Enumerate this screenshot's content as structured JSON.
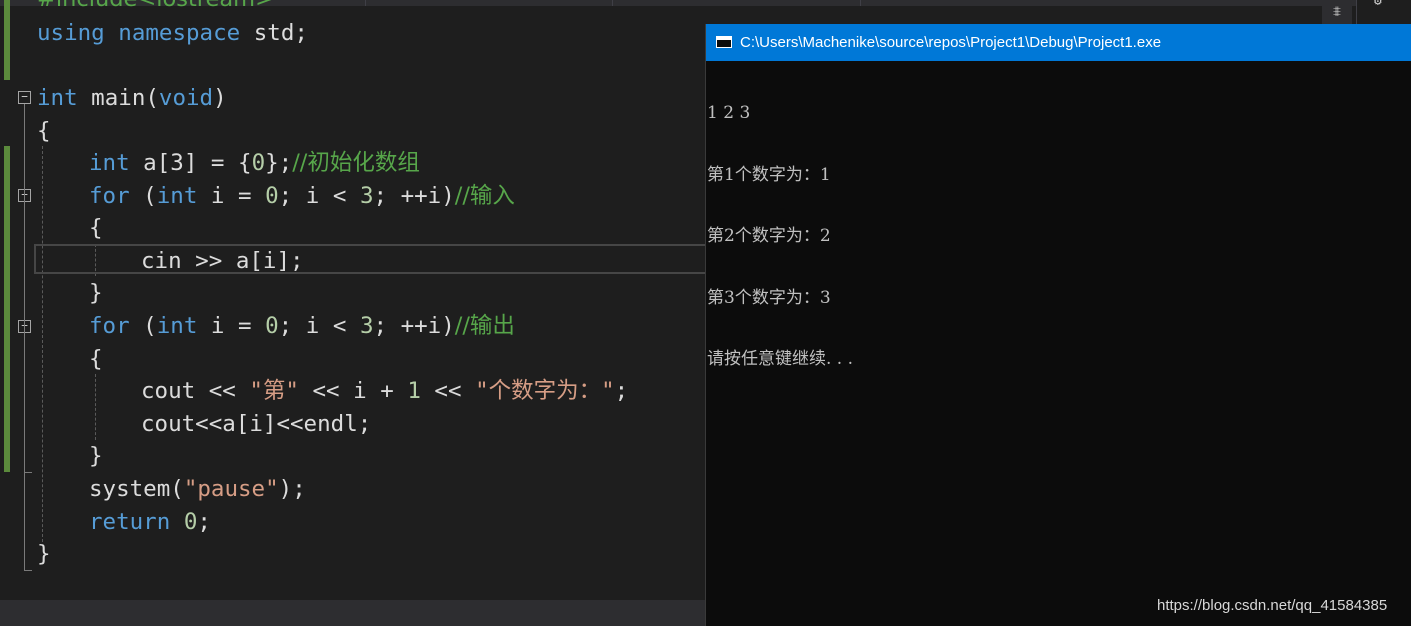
{
  "editor": {
    "lines": [
      {
        "id": "l1",
        "tokens": [
          {
            "t": "#include<iostream>",
            "c": "cm"
          }
        ]
      },
      {
        "id": "l2",
        "tokens": [
          {
            "t": "using",
            "c": "kw"
          },
          {
            "t": " "
          },
          {
            "t": "namespace",
            "c": "kw"
          },
          {
            "t": " std;"
          }
        ]
      },
      {
        "id": "l3",
        "tokens": [
          {
            "t": "int",
            "c": "kw"
          },
          {
            "t": " main("
          },
          {
            "t": "void",
            "c": "kw"
          },
          {
            "t": ")"
          }
        ]
      },
      {
        "id": "l4",
        "tokens": [
          {
            "t": "{"
          }
        ]
      },
      {
        "id": "l5",
        "tokens": [
          {
            "t": "int",
            "c": "kw"
          },
          {
            "t": " a[3] = {"
          },
          {
            "t": "0",
            "c": "nm"
          },
          {
            "t": "};"
          },
          {
            "t": "//初始化数组",
            "c": "cm"
          }
        ]
      },
      {
        "id": "l6",
        "tokens": [
          {
            "t": "for",
            "c": "kw"
          },
          {
            "t": " ("
          },
          {
            "t": "int",
            "c": "kw"
          },
          {
            "t": " i = "
          },
          {
            "t": "0",
            "c": "nm"
          },
          {
            "t": "; i < "
          },
          {
            "t": "3",
            "c": "nm"
          },
          {
            "t": "; ++i)"
          },
          {
            "t": "//输入",
            "c": "cm"
          }
        ]
      },
      {
        "id": "l7",
        "tokens": [
          {
            "t": "{"
          }
        ]
      },
      {
        "id": "l8",
        "tokens": [
          {
            "t": "cin >> a[i];"
          }
        ]
      },
      {
        "id": "l9",
        "tokens": [
          {
            "t": "}"
          }
        ]
      },
      {
        "id": "l10",
        "tokens": [
          {
            "t": "for",
            "c": "kw"
          },
          {
            "t": " ("
          },
          {
            "t": "int",
            "c": "kw"
          },
          {
            "t": " i = "
          },
          {
            "t": "0",
            "c": "nm"
          },
          {
            "t": "; i < "
          },
          {
            "t": "3",
            "c": "nm"
          },
          {
            "t": "; ++i)"
          },
          {
            "t": "//输出",
            "c": "cm"
          }
        ]
      },
      {
        "id": "l11",
        "tokens": [
          {
            "t": "{"
          }
        ]
      },
      {
        "id": "l12",
        "tokens": [
          {
            "t": "cout << "
          },
          {
            "t": "\"第\"",
            "c": "st"
          },
          {
            "t": " << i + "
          },
          {
            "t": "1",
            "c": "nm"
          },
          {
            "t": " << "
          },
          {
            "t": "\"个数字为：\"",
            "c": "st"
          },
          {
            "t": ";"
          }
        ]
      },
      {
        "id": "l13",
        "tokens": [
          {
            "t": "cout<<a[i]<<endl;"
          }
        ]
      },
      {
        "id": "l14",
        "tokens": [
          {
            "t": "}"
          }
        ]
      },
      {
        "id": "l15",
        "tokens": [
          {
            "t": "system("
          },
          {
            "t": "\"pause\"",
            "c": "st"
          },
          {
            "t": ");"
          }
        ]
      },
      {
        "id": "l16",
        "tokens": [
          {
            "t": "return",
            "c": "kw"
          },
          {
            "t": " "
          },
          {
            "t": "0",
            "c": "nm"
          },
          {
            "t": ";"
          }
        ]
      },
      {
        "id": "l17",
        "tokens": [
          {
            "t": "}"
          }
        ]
      }
    ],
    "fold_glyph": "−",
    "split_icon": "split-editor-icon",
    "settings_icon": "gear-icon"
  },
  "console": {
    "title": "C:\\Users\\Machenike\\source\\repos\\Project1\\Debug\\Project1.exe",
    "icon": "console-window-icon",
    "output": [
      "1 2 3",
      "第1个数字为：1",
      "第2个数字为：2",
      "第3个数字为：3",
      "请按任意键继续. . ."
    ]
  },
  "watermark": "https://blog.csdn.net/qq_41584385",
  "colors": {
    "editor_bg": "#1e1e1e",
    "keyword": "#569cd6",
    "comment": "#57a64a",
    "string": "#d69d85",
    "number": "#b5cea8",
    "titlebar": "#0078d7",
    "console_bg": "#0c0c0c"
  }
}
